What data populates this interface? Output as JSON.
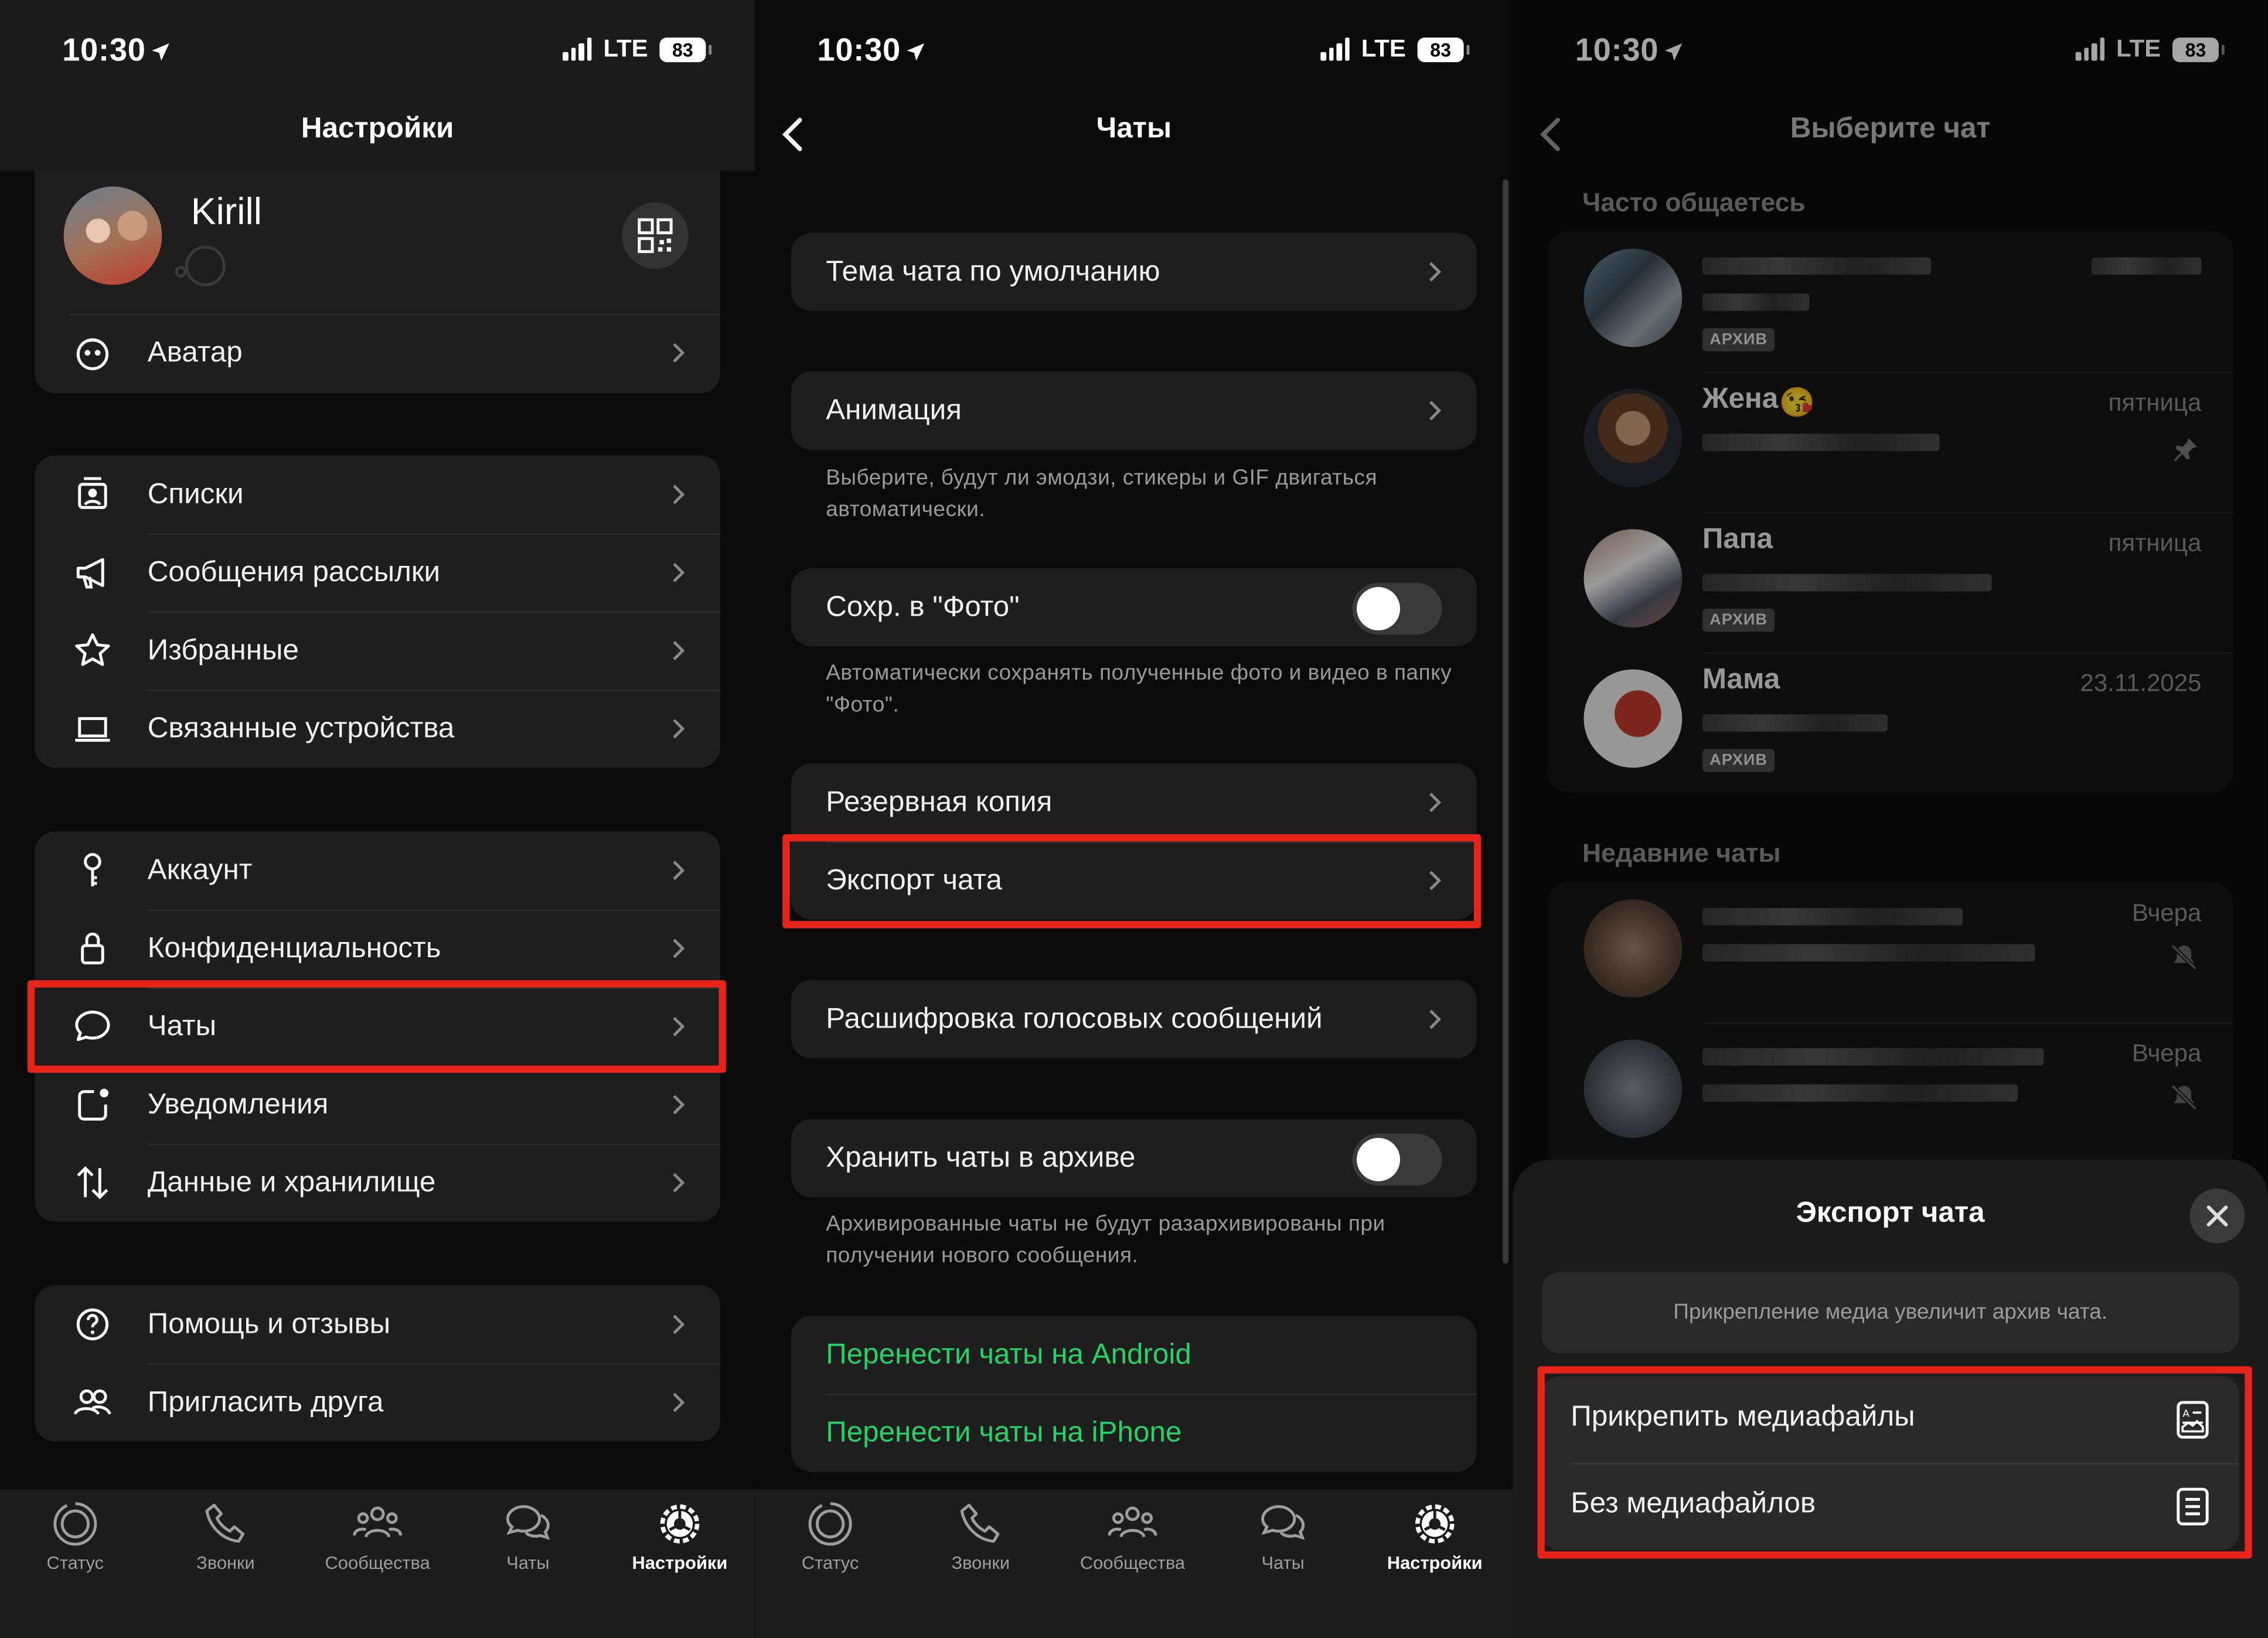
{
  "status": {
    "time": "10:30",
    "network": "LTE",
    "battery": "83"
  },
  "colors": {
    "accent_green": "#25d366",
    "highlight_red": "#e8241a",
    "background": "#0b0b0b",
    "group_bg": "#1e1e1e"
  },
  "panel1": {
    "title": "Настройки",
    "profile": {
      "name": "Kirill"
    },
    "avatar_row": {
      "label": "Аватар",
      "icon": "avatar-face-icon"
    },
    "group2": [
      {
        "label": "Списки",
        "icon": "lists-icon"
      },
      {
        "label": "Сообщения рассылки",
        "icon": "megaphone-icon"
      },
      {
        "label": "Избранные",
        "icon": "star-icon"
      },
      {
        "label": "Связанные устройства",
        "icon": "laptop-icon"
      }
    ],
    "group3": [
      {
        "label": "Аккаунт",
        "icon": "key-icon"
      },
      {
        "label": "Конфиденциальность",
        "icon": "lock-icon"
      },
      {
        "label": "Чаты",
        "icon": "chat-bubble-icon"
      },
      {
        "label": "Уведомления",
        "icon": "notification-icon"
      },
      {
        "label": "Данные и хранилище",
        "icon": "data-arrows-icon"
      }
    ],
    "group4": [
      {
        "label": "Помощь и отзывы",
        "icon": "help-icon"
      },
      {
        "label": "Пригласить друга",
        "icon": "people-icon"
      }
    ]
  },
  "tabs": [
    {
      "label": "Статус",
      "icon": "status-icon"
    },
    {
      "label": "Звонки",
      "icon": "phone-icon"
    },
    {
      "label": "Сообщества",
      "icon": "communities-icon"
    },
    {
      "label": "Чаты",
      "icon": "chats-icon"
    },
    {
      "label": "Настройки",
      "icon": "settings-icon",
      "active": true
    }
  ],
  "panel2": {
    "title": "Чаты",
    "theme": "Тема чата по умолчанию",
    "animation": "Анимация",
    "animation_note": "Выберите, будут ли эмодзи, стикеры и GIF двигаться автоматически.",
    "save_photos": "Сохр. в \"Фото\"",
    "save_photos_note": "Автоматически сохранять полученные фото и видео в папку \"Фото\".",
    "backup": "Резервная копия",
    "export": "Экспорт чата",
    "transcription": "Расшифровка голосовых сообщений",
    "archive": "Хранить чаты в архиве",
    "archive_note": "Архивированные чаты не будут разархивированы при получении нового сообщения.",
    "move_android": "Перенести чаты на Android",
    "move_iphone": "Перенести чаты на iPhone"
  },
  "panel3": {
    "title": "Выберите чат",
    "frequent_label": "Часто общаетесь",
    "recent_label": "Недавние чаты",
    "frequent": [
      {
        "name": "",
        "date": "",
        "badge": "АРХИВ"
      },
      {
        "name": "Жена",
        "date": "пятница",
        "badge": ""
      },
      {
        "name": "Папа",
        "date": "пятница",
        "badge": "АРХИВ"
      },
      {
        "name": "Мама",
        "date": "23.11.2025",
        "badge": "АРХИВ"
      }
    ],
    "recent": [
      {
        "date": "Вчера"
      },
      {
        "date": "Вчера"
      }
    ],
    "sheet": {
      "title": "Экспорт чата",
      "info": "Прикрепление медиа увеличит архив чата.",
      "attach": "Прикрепить медиафайлы",
      "no_media": "Без медиафайлов"
    }
  }
}
